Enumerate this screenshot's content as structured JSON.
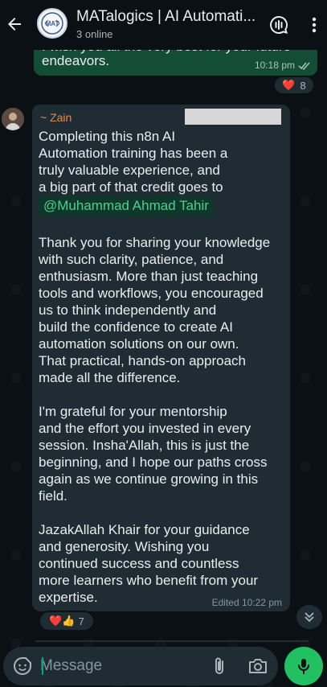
{
  "header": {
    "title": "MATalogics | AI Automati...",
    "subtitle": "3 online",
    "avatar_text": "MAT"
  },
  "prev_message": {
    "cut_text": "I wish you all the very best for your future",
    "text": "endeavors.",
    "time": "10:18 pm",
    "reaction_emoji": "❤️",
    "reaction_count": "8"
  },
  "message": {
    "sender": "~ Zain",
    "lines_a": [
      "Completing this n8n AI",
      "Automation training has been a",
      "truly valuable experience, and",
      "a big part of that credit goes to"
    ],
    "mention": "@Muhammad Ahmad Tahir",
    "lines_b": [
      "Thank you for sharing your knowledge",
      "with such clarity, patience, and",
      "enthusiasm. More than just teaching",
      "tools and workflows, you encouraged",
      "us to think independently and",
      "build the confidence to create AI",
      "automation solutions on our own.",
      "That practical, hands-on approach",
      "made all the difference."
    ],
    "lines_c": [
      "I'm grateful for your mentorship",
      "and the effort you invested in every",
      "session. Insha'Allah, this is just the",
      "beginning, and I hope our paths cross",
      "again as we continue growing in this",
      "field."
    ],
    "lines_d": [
      "JazakAllah Khair for your guidance",
      "and generosity. Wishing you",
      "continued success and countless",
      "more learners who benefit from your",
      "expertise."
    ],
    "time": "Edited 10:22 pm",
    "reactions": "❤️👍",
    "reaction_count": "7"
  },
  "composer": {
    "placeholder": "Message"
  },
  "colors": {
    "background": "#0b1014",
    "incoming_bubble": "#1f2c33",
    "outgoing_bubble": "#144d37",
    "sender_name": "#e5894b",
    "mention": "#4ad08c",
    "mic_button": "#21c063"
  },
  "icons": {
    "back": "arrow-left-icon",
    "call": "call-add-icon",
    "menu": "more-vertical-icon",
    "scroll": "double-chevron-down-icon",
    "emoji": "sticker-icon",
    "attach": "paperclip-icon",
    "camera": "camera-icon",
    "mic": "mic-icon"
  }
}
